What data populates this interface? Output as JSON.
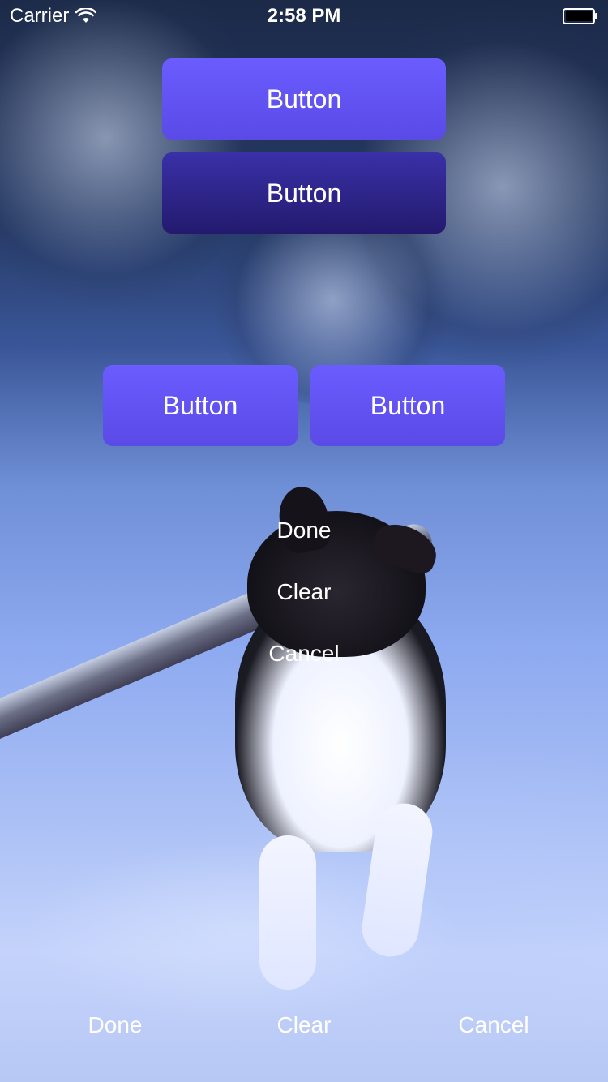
{
  "status_bar": {
    "carrier": "Carrier",
    "time": "2:58 PM",
    "wifi_icon": "wifi-icon",
    "battery_icon": "battery-icon"
  },
  "buttons": {
    "top_1": "Button",
    "top_2": "Button",
    "middle_left": "Button",
    "middle_right": "Button"
  },
  "center_actions": {
    "done": "Done",
    "clear": "Clear",
    "cancel": "Cancel"
  },
  "bottom_actions": {
    "done": "Done",
    "clear": "Clear",
    "cancel": "Cancel"
  },
  "colors": {
    "button_light": "#6b5cff",
    "button_dark": "#2b227f",
    "text": "#ffffff"
  }
}
